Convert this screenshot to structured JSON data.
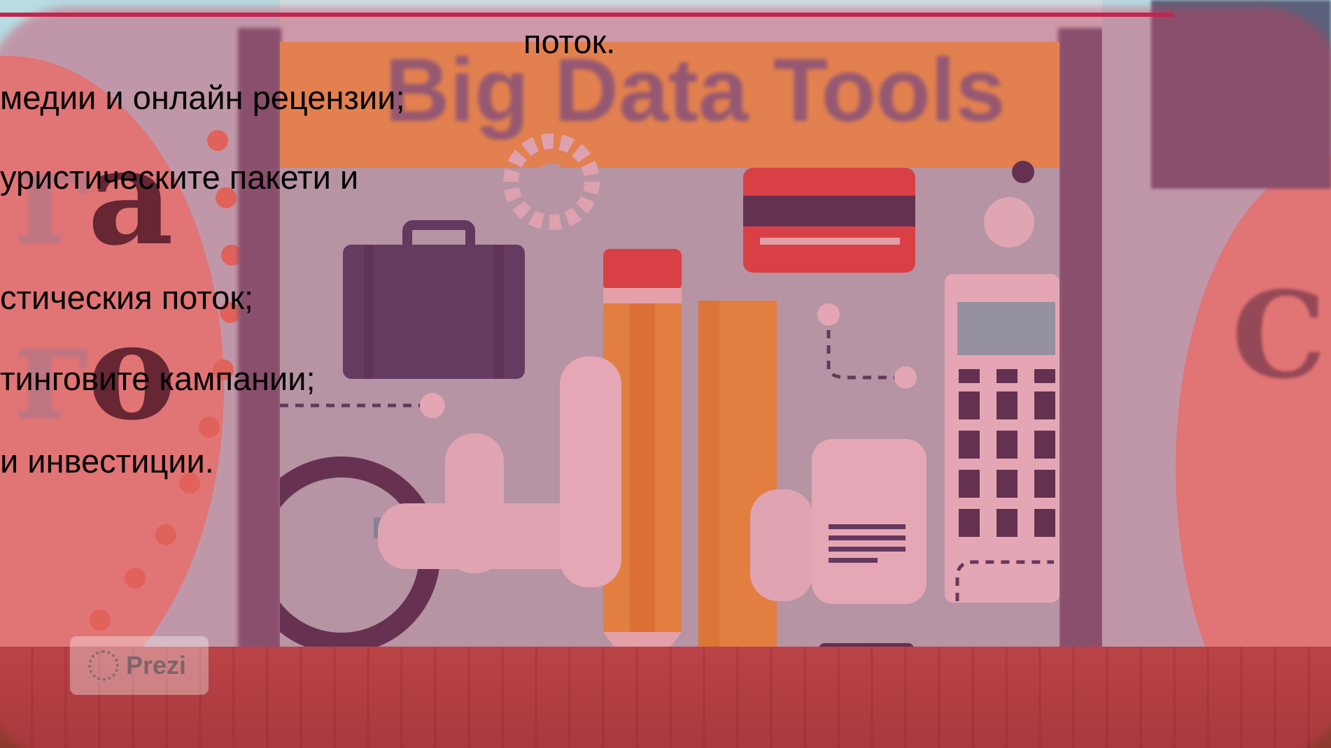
{
  "background": {
    "title": "Big Data Tools",
    "logo": "Prezi",
    "left_letters": [
      "а",
      "о"
    ],
    "colors": {
      "wash": "#cd3755",
      "rule": "#c4244e",
      "banner": "#f2b64b",
      "floor": "#b85242"
    }
  },
  "slide": {
    "heading_fragment": "поток.",
    "bullets": [
      "медии и онлайн рецензии;",
      "уристическите пакети и",
      "стическия поток;",
      "тинговите кампании;",
      "и инвестиции."
    ]
  }
}
